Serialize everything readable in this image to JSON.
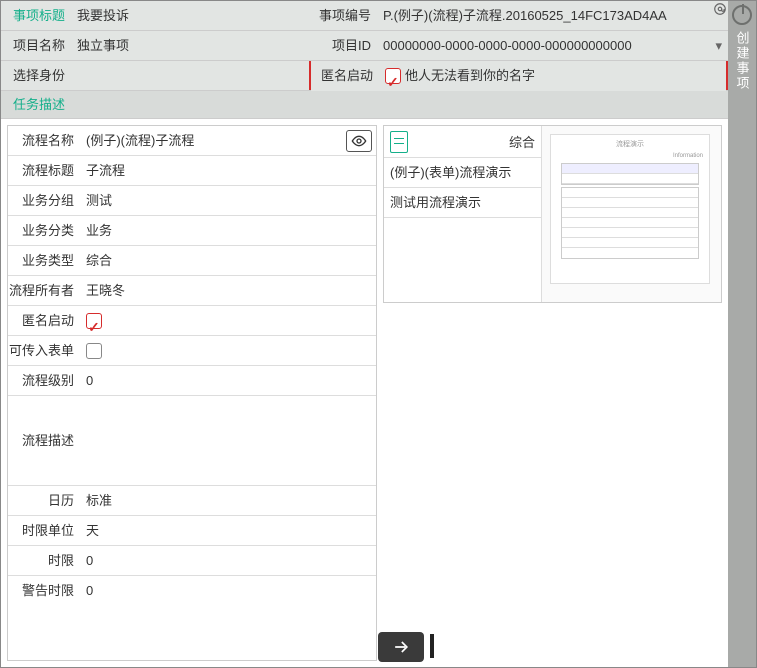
{
  "header": {
    "row1": {
      "label1": "事项标题",
      "value1": "我要投诉",
      "label2": "事项编号",
      "value2": "P.(例子)(流程)子流程.20160525_14FC173AD4AA"
    },
    "row2": {
      "label1": "项目名称",
      "value1": "独立事项",
      "label2": "项目ID",
      "value2": "00000000-0000-0000-0000-000000000000"
    },
    "row3": {
      "label1": "选择身份",
      "value1": "",
      "label2": "匿名启动",
      "value2": "他人无法看到你的名字"
    }
  },
  "task_desc_label": "任务描述",
  "details": {
    "rows": [
      {
        "label": "流程名称",
        "value": "(例子)(流程)子流程"
      },
      {
        "label": "流程标题",
        "value": "子流程"
      },
      {
        "label": "业务分组",
        "value": "测试"
      },
      {
        "label": "业务分类",
        "value": "业务"
      },
      {
        "label": "业务类型",
        "value": "综合"
      },
      {
        "label": "流程所有者",
        "value": "王晓冬"
      },
      {
        "label": "匿名启动",
        "value": ""
      },
      {
        "label": "可传入表单",
        "value": ""
      },
      {
        "label": "流程级别",
        "value": "0"
      },
      {
        "label": "流程描述",
        "value": ""
      },
      {
        "label": "日历",
        "value": "标准"
      },
      {
        "label": "时限单位",
        "value": "天"
      },
      {
        "label": "时限",
        "value": "0"
      },
      {
        "label": "警告时限",
        "value": "0"
      }
    ]
  },
  "right": {
    "tag": "综合",
    "items": [
      "(例子)(表单)流程演示",
      "测试用流程演示"
    ],
    "preview": {
      "title": "流程演示",
      "sub": "Information"
    }
  },
  "sidebar": {
    "text": "创建事项"
  }
}
